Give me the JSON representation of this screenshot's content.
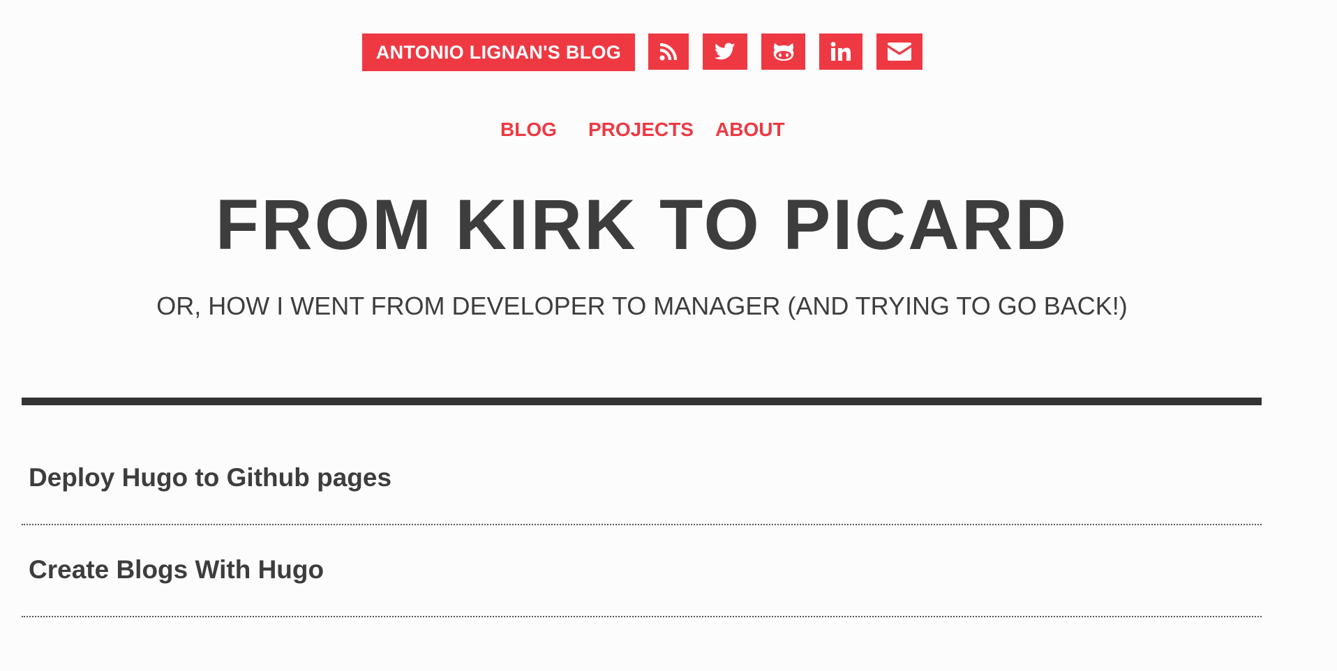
{
  "header": {
    "brand_label": "ANTONIO LIGNAN'S BLOG",
    "social_icons": [
      "rss-icon",
      "twitter-icon",
      "github-icon",
      "linkedin-icon",
      "mail-icon"
    ],
    "accent_color": "#ee3943"
  },
  "nav": {
    "items": [
      {
        "label": "BLOG"
      },
      {
        "label": "PROJECTS"
      },
      {
        "label": "ABOUT"
      }
    ]
  },
  "hero": {
    "title": "FROM KIRK TO PICARD",
    "subtitle": "OR, HOW I WENT FROM DEVELOPER TO MANAGER (AND TRYING TO GO BACK!)"
  },
  "posts": [
    {
      "title": "Deploy Hugo to Github pages"
    },
    {
      "title": "Create Blogs With Hugo"
    }
  ],
  "colors": {
    "text": "#3d3d3d",
    "rule": "#333333",
    "background": "#fdfcfc"
  }
}
